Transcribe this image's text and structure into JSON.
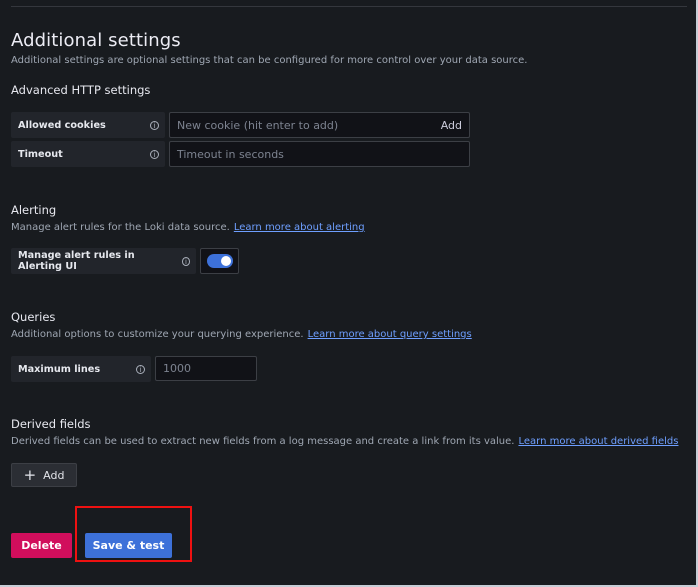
{
  "header": {
    "title": "Additional settings",
    "description": "Additional settings are optional settings that can be configured for more control over your data source."
  },
  "advanced_http": {
    "title": "Advanced HTTP settings",
    "allowed_cookies": {
      "label": "Allowed cookies",
      "placeholder": "New cookie (hit enter to add)",
      "add_label": "Add"
    },
    "timeout": {
      "label": "Timeout",
      "placeholder": "Timeout in seconds"
    }
  },
  "alerting": {
    "title": "Alerting",
    "description": "Manage alert rules for the Loki data source.",
    "link": "Learn more about alerting",
    "manage_label": "Manage alert rules in Alerting UI",
    "manage_enabled": true
  },
  "queries": {
    "title": "Queries",
    "description": "Additional options to customize your querying experience.",
    "link": "Learn more about query settings",
    "max_lines_label": "Maximum lines",
    "max_lines_placeholder": "1000"
  },
  "derived_fields": {
    "title": "Derived fields",
    "description": "Derived fields can be used to extract new fields from a log message and create a link from its value.",
    "link": "Learn more about derived fields",
    "add_label": "Add"
  },
  "actions": {
    "delete_label": "Delete",
    "save_label": "Save & test"
  },
  "icons": {
    "info": "info-icon",
    "plus": "plus-icon"
  },
  "colors": {
    "background": "#181b1f",
    "primary": "#3d71d9",
    "destructive": "#d10e5c",
    "highlight": "#ee1111",
    "link": "#6e9fff"
  }
}
